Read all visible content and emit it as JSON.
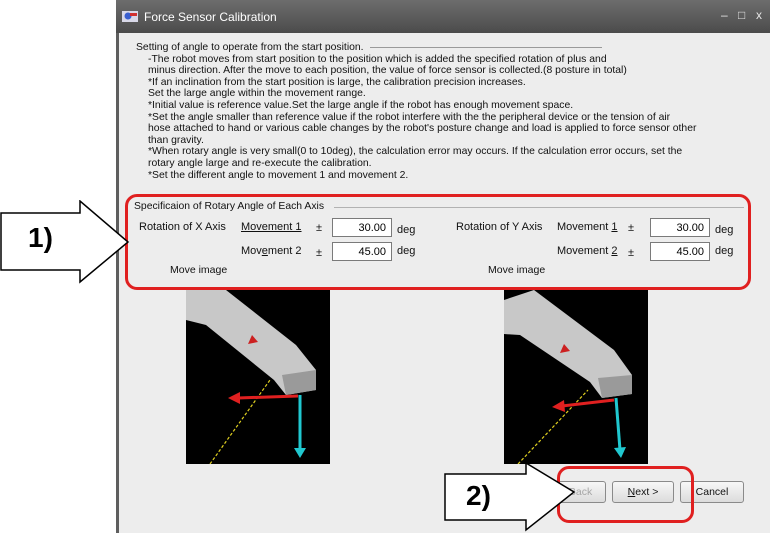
{
  "window": {
    "title": "Force Sensor Calibration",
    "minimize": "–",
    "restore": "□",
    "close": "x"
  },
  "instructions": {
    "heading": "Setting of angle to operate from the start position.",
    "lines": [
      "-The robot moves from start position to the position which is added the specified rotation of plus and",
      "minus direction. After the move to each position, the value of force sensor is collected.(8 posture in total)",
      "*If an inclination from the start position is large, the calibration precision increases.",
      "Set the large angle within the movement range.",
      "*Initial value is  reference value.Set the large angle if the robot has enough movement space.",
      "*Set the angle smaller than reference value if the robot interfere with the the peripheral device or the tension of air",
      "hose attached to hand or various cable changes by the robot's posture change and load is applied to force sensor other",
      "than gravity.",
      "*When rotary angle is very small(0 to 10deg), the calculation error may occurs. If the calculation error occurs, set the",
      "rotary angle large and re-execute the calibration.",
      "*Set the different angle to movement 1 and movement 2."
    ]
  },
  "group": {
    "title": "Specificaion of Rotary Angle of Each Axis",
    "x_axis": {
      "label": "Rotation of X Axis",
      "movement1_prefix": "Movement 1",
      "movement2_prefix_a": "Mov",
      "movement2_prefix_u": "e",
      "movement2_prefix_b": "ment 2",
      "pm": "±",
      "movement1_value": "30.00",
      "movement2_value": "45.00",
      "unit": "deg",
      "move_image_label": "Move image"
    },
    "y_axis": {
      "label": "Rotation of Y Axis",
      "movement1_prefix": "Movement ",
      "movement1_underlined": "1",
      "movement2_prefix": "Movement ",
      "movement2_underlined": "2",
      "pm": "±",
      "movement1_value": "30.00",
      "movement2_value": "45.00",
      "unit": "deg",
      "move_image_label": "Move image"
    }
  },
  "buttons": {
    "back": "< Back",
    "next_u": "N",
    "next_rest": "ext >",
    "cancel": "Cancel"
  },
  "callouts": {
    "one": "1)",
    "two": "2)"
  },
  "colors": {
    "highlight": "#e02020",
    "title_bar": "#555555",
    "window_bg": "#ededed"
  }
}
